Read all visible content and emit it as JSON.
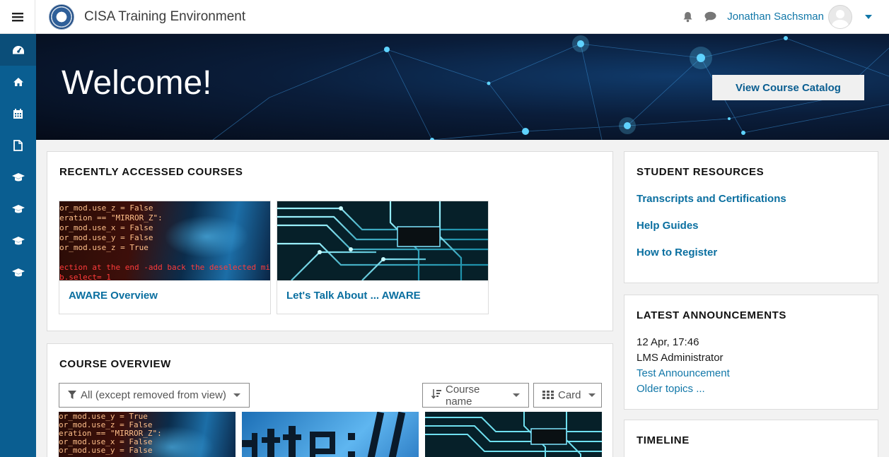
{
  "navbar": {
    "site_title": "CISA Training Environment",
    "user_name": "Jonathan Sachsman",
    "menu_icon": "hamburger-icon",
    "notification_icon": "bell-icon",
    "messages_icon": "chat-icon"
  },
  "rail": {
    "items": [
      {
        "icon": "dashboard-icon"
      },
      {
        "icon": "home-icon"
      },
      {
        "icon": "calendar-icon"
      },
      {
        "icon": "file-icon"
      },
      {
        "icon": "graduation-cap-icon"
      },
      {
        "icon": "graduation-cap-icon"
      },
      {
        "icon": "graduation-cap-icon"
      },
      {
        "icon": "graduation-cap-icon"
      }
    ]
  },
  "hero": {
    "title": "Welcome!",
    "button_label": "View Course Catalog"
  },
  "recent": {
    "heading": "RECENTLY ACCESSED COURSES",
    "courses": [
      {
        "name": "AWARE Overview"
      },
      {
        "name": "Let's Talk About ... AWARE"
      }
    ]
  },
  "overview": {
    "heading": "COURSE OVERVIEW",
    "filter_label": "All (except removed from view)",
    "sort_label": "Course name",
    "view_label": "Card"
  },
  "code_lines": {
    "a": [
      "or_mod.use_z = False",
      "eration == \"MIRROR_Z\":",
      "or_mod.use_x = False",
      "or_mod.use_y = False",
      "or_mod.use_z = True",
      "ection at the end -add back the deselected mir",
      "b.select= 1"
    ],
    "b": [
      "or_mod.use_y = True",
      "or_mod.use_z = False",
      "eration == \"MIRROR_Z\":",
      "or_mod.use_x = False",
      "or_mod.use_y = False"
    ]
  },
  "resources": {
    "heading": "STUDENT RESOURCES",
    "links": [
      "Transcripts and Certifications",
      "Help Guides",
      "How to Register"
    ]
  },
  "announcements": {
    "heading": "LATEST ANNOUNCEMENTS",
    "date": "12 Apr, 17:46",
    "author": "LMS Administrator",
    "title": "Test Announcement",
    "older": "Older topics ..."
  },
  "timeline": {
    "heading": "TIMELINE"
  }
}
